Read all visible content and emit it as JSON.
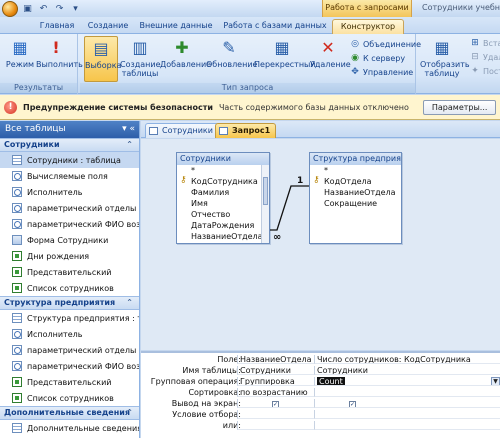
{
  "window": {
    "context_group": "Работа с запросами",
    "app_title": "Сотрудники учебная : б"
  },
  "ribbon_tabs": [
    "Главная",
    "Создание",
    "Внешние данные",
    "Работа с базами данных",
    "Конструктор"
  ],
  "active_tab": "Конструктор",
  "ribbon": {
    "results": {
      "label": "Результаты",
      "view": "Режим",
      "run": "Выполнить"
    },
    "query_type": {
      "label": "Тип запроса",
      "select": "Выборка",
      "make_table": "Создание таблицы",
      "append": "Добавление",
      "update": "Обновление",
      "crosstab": "Перекрестный",
      "delete": "Удаление",
      "union": "Объединение",
      "pass_through": "К серверу",
      "data_definition": "Управление"
    },
    "query_setup": {
      "show_table": "Отобразить таблицу",
      "insert_rows": "Вста",
      "delete_rows": "Удал",
      "builder": "Пост"
    }
  },
  "security_bar": {
    "title": "Предупреждение системы безопасности",
    "message": "Часть содержимого базы данных отключено",
    "button": "Параметры..."
  },
  "nav": {
    "header": "Все таблицы",
    "groups": [
      {
        "name": "Сотрудники",
        "items": [
          {
            "label": "Сотрудники : таблица",
            "icon": "table-icon",
            "selected": true
          },
          {
            "label": "Вычисляемые поля",
            "icon": "query-icon"
          },
          {
            "label": "Исполнитель",
            "icon": "query-icon"
          },
          {
            "label": "параметрический отделы",
            "icon": "query-icon"
          },
          {
            "label": "параметрический ФИО возр...",
            "icon": "query-icon"
          },
          {
            "label": "Форма Сотрудники",
            "icon": "form-icon"
          },
          {
            "label": "Дни рождения",
            "icon": "report-icon"
          },
          {
            "label": "Представительский",
            "icon": "report-icon"
          },
          {
            "label": "Список сотрудников",
            "icon": "report-icon"
          }
        ]
      },
      {
        "name": "Структура предприятия",
        "items": [
          {
            "label": "Структура предприятия : та...",
            "icon": "table-icon"
          },
          {
            "label": "Исполнитель",
            "icon": "query-icon"
          },
          {
            "label": "параметрический отделы",
            "icon": "query-icon"
          },
          {
            "label": "параметрический ФИО возр...",
            "icon": "query-icon"
          },
          {
            "label": "Представительский",
            "icon": "report-icon"
          },
          {
            "label": "Список сотрудников",
            "icon": "report-icon"
          }
        ]
      },
      {
        "name": "Дополнительные сведения",
        "items": [
          {
            "label": "Дополнительные сведения :...",
            "icon": "table-icon"
          }
        ]
      }
    ]
  },
  "doc_tabs": [
    "Сотрудники",
    "Запрос1"
  ],
  "active_doc_tab": "Запрос1",
  "tables": [
    {
      "name": "Сотрудники",
      "fields": [
        "*",
        "КодСотрудника",
        "Фамилия",
        "Имя",
        "Отчество",
        "ДатаРождения",
        "НазваниеОтдела"
      ],
      "key_field": "КодСотрудника"
    },
    {
      "name": "Структура предприятия",
      "header_display": "Структура предприя...",
      "fields": [
        "*",
        "КодОтдела",
        "НазваниеОтдела",
        "Сокращение"
      ],
      "key_field": "КодОтдела"
    }
  ],
  "relationship": {
    "one_side": "1",
    "many_side": "∞"
  },
  "grid": {
    "row_labels": [
      "Поле:",
      "Имя таблицы:",
      "Групповая операция:",
      "Сортировка:",
      "Вывод на экран:",
      "Условие отбора:",
      "или:"
    ],
    "columns": [
      {
        "field": "НазваниеОтдела",
        "table": "Сотрудники",
        "total": "Группировка",
        "sort": "по возрастанию",
        "show": true
      },
      {
        "field": "Число сотрудников: КодСотрудника",
        "table": "Сотрудники",
        "total": "Count",
        "sort": "",
        "show": true
      }
    ]
  },
  "colors": {
    "accent": "#f7c54b",
    "nav_header": "#2d5ea9",
    "security_bar": "#fff5cf"
  }
}
